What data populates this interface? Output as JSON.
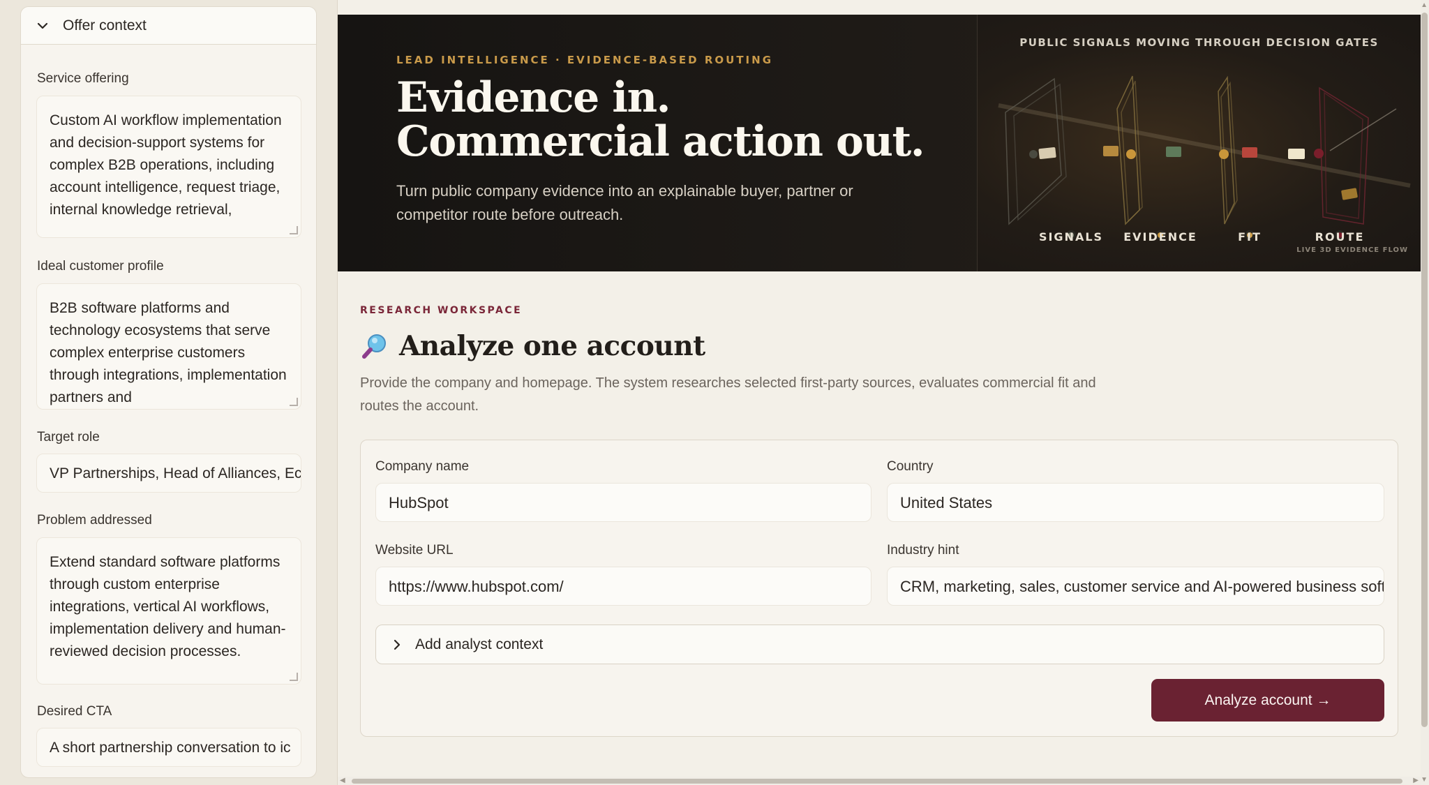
{
  "sidebar": {
    "header": "Offer context",
    "fields": [
      {
        "label": "Service offering",
        "value": "Custom AI workflow implementation and decision-support systems for complex B2B operations, including account intelligence, request triage, internal knowledge retrieval,"
      },
      {
        "label": "Ideal customer profile",
        "value": "B2B software platforms and technology ecosystems that serve complex enterprise customers through integrations, implementation partners and"
      },
      {
        "label": "Target role",
        "value": "VP Partnerships, Head of Alliances, Ec"
      },
      {
        "label": "Problem addressed",
        "value": "Extend standard software platforms through custom enterprise integrations, vertical AI workflows, implementation delivery and human-reviewed decision processes."
      },
      {
        "label": "Desired CTA",
        "value": "A short partnership conversation to ic"
      }
    ]
  },
  "hero": {
    "eyebrow": "LEAD INTELLIGENCE · EVIDENCE-BASED ROUTING",
    "title_line1": "Evidence in.",
    "title_line2": "Commercial action out.",
    "subtitle": "Turn public company evidence into an explainable buyer, partner or competitor route before outreach.",
    "viz_title": "PUBLIC SIGNALS MOVING THROUGH DECISION GATES",
    "gates": [
      "SIGNALS",
      "EVIDENCE",
      "FIT",
      "ROUTE"
    ],
    "viz_footer": "LIVE 3D EVIDENCE FLOW"
  },
  "workspace": {
    "eyebrow": "RESEARCH WORKSPACE",
    "title_icon": "magnifying-glass-icon",
    "title": "Analyze one account",
    "description": "Provide the company and homepage. The system researches selected first-party sources, evaluates commercial fit and routes the account."
  },
  "form": {
    "company_label": "Company name",
    "company_value": "HubSpot",
    "country_label": "Country",
    "country_value": "United States",
    "website_label": "Website URL",
    "website_value": "https://www.hubspot.com/",
    "industry_label": "Industry hint",
    "industry_value": "CRM, marketing, sales, customer service and AI-powered business softw",
    "expander_label": "Add analyst context",
    "submit_label": "Analyze account →"
  },
  "colors": {
    "accent": "#6a2232",
    "eyebrow_gold": "#c99a4a",
    "eyebrow_maroon": "#7a2638",
    "hero_bg": "#1b1714",
    "page_bg": "#f3f0e8"
  }
}
